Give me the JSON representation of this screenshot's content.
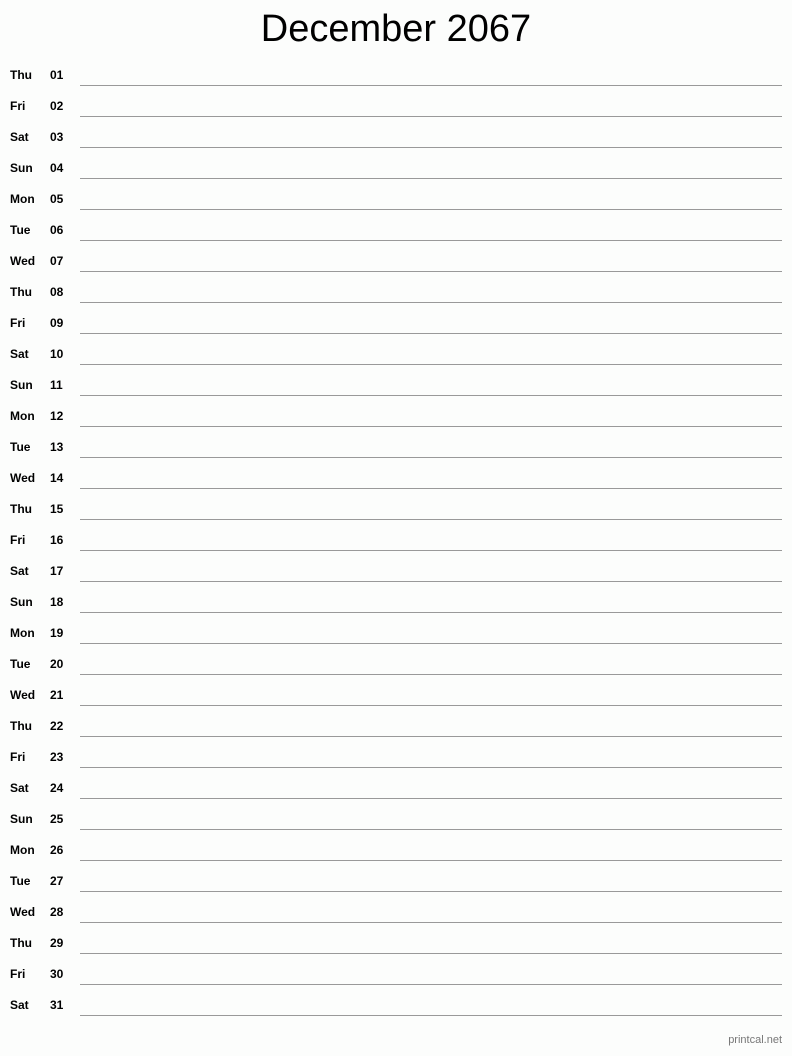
{
  "title": "December 2067",
  "days": [
    {
      "dow": "Thu",
      "num": "01"
    },
    {
      "dow": "Fri",
      "num": "02"
    },
    {
      "dow": "Sat",
      "num": "03"
    },
    {
      "dow": "Sun",
      "num": "04"
    },
    {
      "dow": "Mon",
      "num": "05"
    },
    {
      "dow": "Tue",
      "num": "06"
    },
    {
      "dow": "Wed",
      "num": "07"
    },
    {
      "dow": "Thu",
      "num": "08"
    },
    {
      "dow": "Fri",
      "num": "09"
    },
    {
      "dow": "Sat",
      "num": "10"
    },
    {
      "dow": "Sun",
      "num": "11"
    },
    {
      "dow": "Mon",
      "num": "12"
    },
    {
      "dow": "Tue",
      "num": "13"
    },
    {
      "dow": "Wed",
      "num": "14"
    },
    {
      "dow": "Thu",
      "num": "15"
    },
    {
      "dow": "Fri",
      "num": "16"
    },
    {
      "dow": "Sat",
      "num": "17"
    },
    {
      "dow": "Sun",
      "num": "18"
    },
    {
      "dow": "Mon",
      "num": "19"
    },
    {
      "dow": "Tue",
      "num": "20"
    },
    {
      "dow": "Wed",
      "num": "21"
    },
    {
      "dow": "Thu",
      "num": "22"
    },
    {
      "dow": "Fri",
      "num": "23"
    },
    {
      "dow": "Sat",
      "num": "24"
    },
    {
      "dow": "Sun",
      "num": "25"
    },
    {
      "dow": "Mon",
      "num": "26"
    },
    {
      "dow": "Tue",
      "num": "27"
    },
    {
      "dow": "Wed",
      "num": "28"
    },
    {
      "dow": "Thu",
      "num": "29"
    },
    {
      "dow": "Fri",
      "num": "30"
    },
    {
      "dow": "Sat",
      "num": "31"
    }
  ],
  "footer": "printcal.net"
}
